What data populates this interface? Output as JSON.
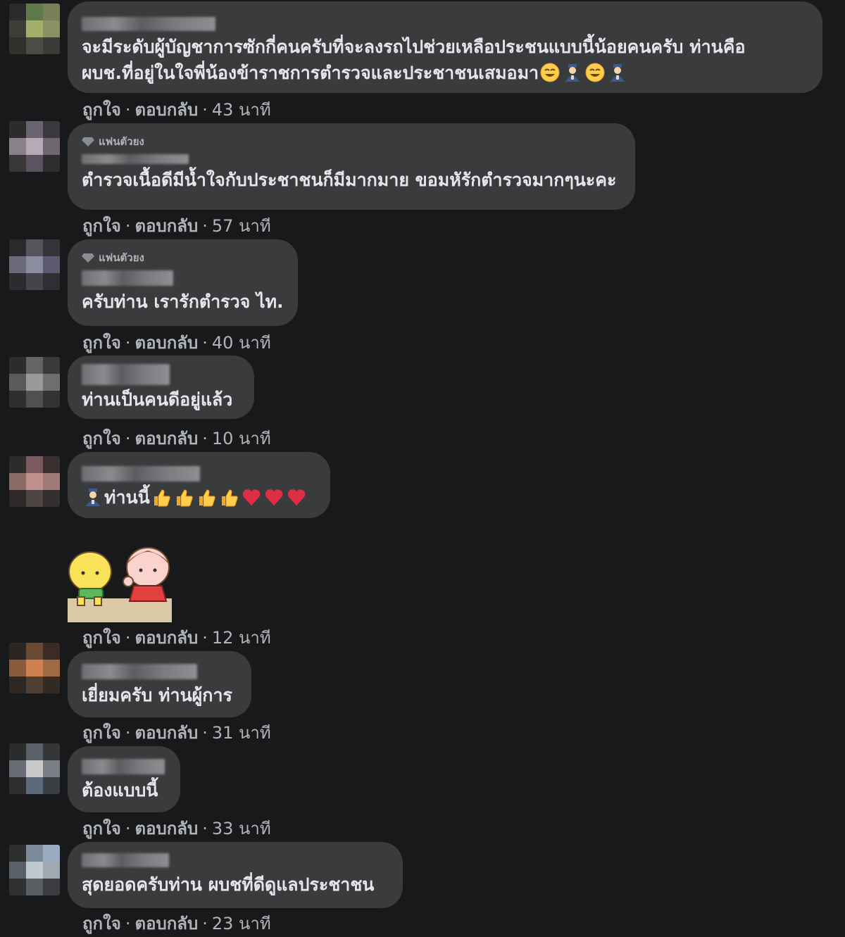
{
  "actions": {
    "like": "ถูกใจ",
    "reply": "ตอบกลับ",
    "separator": "·"
  },
  "badge_label": "แฟนตัวยง",
  "comments": [
    {
      "text_lines": [
        "จะมีระดับผู้บัญชาการซักกี่คนครับที่จะลงรถไปช่วยเหลือประชนแบบนี้น้อยคนครับ ท่านคือ",
        "ผบช.ที่อยู่ในใจพี่น้องข้าราชการตำรวจและประชาชนเสมอมา"
      ],
      "time": "43 นาที"
    },
    {
      "text_lines": [
        "ตำรวจเนื้อดีมีน้ำใจกับประชาชนก็มีมากมาย ขอมหัรักตำรวจมากๆนะคะ"
      ],
      "time": "57 นาที"
    },
    {
      "text_lines": [
        "ครับท่าน เรารักตำรวจ ไท."
      ],
      "time": "40 นาที"
    },
    {
      "text_lines": [
        "ท่านเป็นคนดีอยู่แล้ว"
      ],
      "time": "10 นาที"
    },
    {
      "text_lines": [
        "ท่านนี้"
      ],
      "time": "12 นาที"
    },
    {
      "text_lines": [
        "เยี่ยมครับ ท่านผู้การ"
      ],
      "time": "31 นาที"
    },
    {
      "text_lines": [
        "ต้องแบบนี้"
      ],
      "time": "33 นาที"
    },
    {
      "text_lines": [
        "สุดยอดครับท่าน ผบชที่ดีดูแลประชาชน"
      ],
      "time": "23 นาที"
    }
  ],
  "icons": {
    "smile": "smiling-face-emoji",
    "officer": "police-officer-emoji",
    "thumb": "thumbs-up-emoji",
    "heart": "red-heart-emoji",
    "gem": "diamond-badge-icon"
  }
}
